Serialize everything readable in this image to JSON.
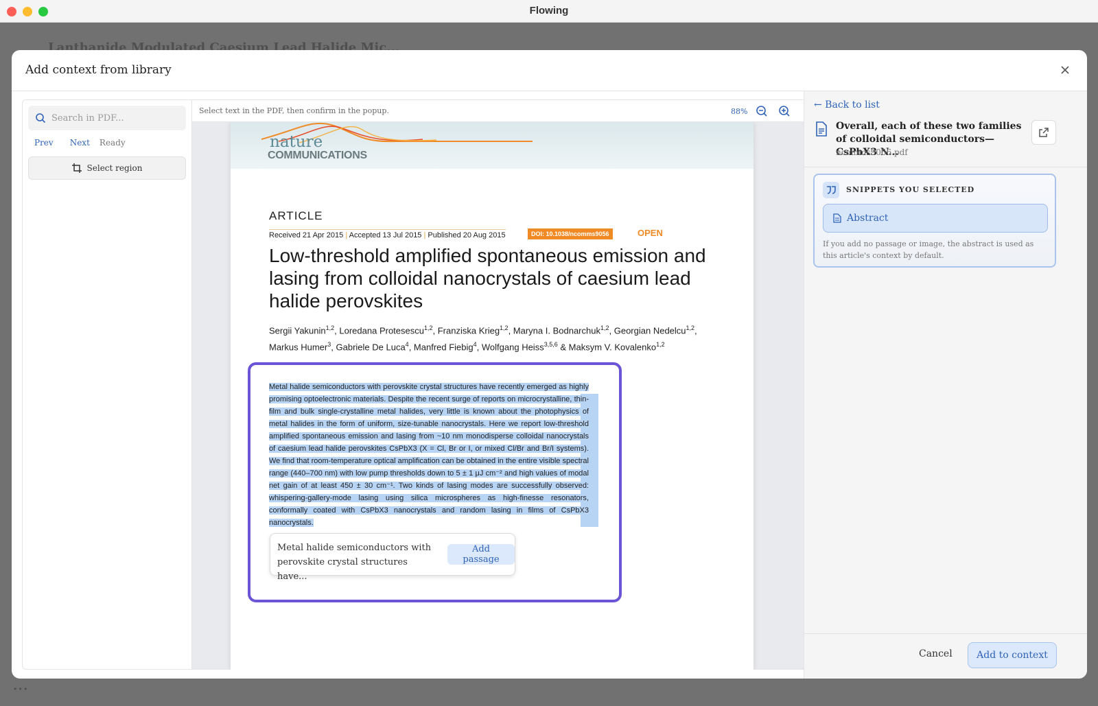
{
  "window": {
    "title": "Flowing"
  },
  "background": {
    "title": "Lanthanide Modulated Caesium Lead Halide Mic...",
    "status": "• • •"
  },
  "modal": {
    "title": "Add context from library",
    "close_icon": "close-icon"
  },
  "sidebar": {
    "search_placeholder": "Search in PDF...",
    "prev_label": "Prev",
    "next_label": "Next",
    "status": "Ready",
    "region_button": "Select region"
  },
  "viewer": {
    "hint": "Select text in the PDF, then confirm in the popup.",
    "zoom": "88%"
  },
  "pdf": {
    "logo_top": "nature",
    "logo_bottom": "COMMUNICATIONS",
    "article_label": "ARTICLE",
    "received": "Received 21 Apr 2015",
    "accepted": "Accepted 13 Jul 2015",
    "published": "Published 20 Aug 2015",
    "doi": "DOI: 10.1038/ncomms9056",
    "open": "OPEN",
    "title": "Low-threshold amplified spontaneous emission and lasing from colloidal nanocrystals of caesium lead halide perovskites",
    "authors": [
      {
        "name": "Sergii Yakunin",
        "aff": "1,2"
      },
      {
        "name": "Loredana Protesescu",
        "aff": "1,2"
      },
      {
        "name": "Franziska Krieg",
        "aff": "1,2"
      },
      {
        "name": "Maryna I. Bodnarchuk",
        "aff": "1,2"
      },
      {
        "name": "Georgian Nedelcu",
        "aff": "1,2"
      },
      {
        "name": "Markus Humer",
        "aff": "3"
      },
      {
        "name": "Gabriele De Luca",
        "aff": "4"
      },
      {
        "name": "Manfred Fiebig",
        "aff": "4"
      },
      {
        "name": "Wolfgang Heiss",
        "aff": "3,5,6"
      },
      {
        "name": "Maksym V. Kovalenko",
        "aff": "1,2"
      }
    ],
    "abstract": "Metal halide semiconductors with perovskite crystal structures have recently emerged as highly promising optoelectronic materials. Despite the recent surge of reports on microcrystalline, thin-film and bulk single-crystalline metal halides, very little is known about the photophysics of metal halides in the form of uniform, size-tunable nanocrystals. Here we report low-threshold amplified spontaneous emission and lasing from ~10 nm monodisperse colloidal nanocrystals of caesium lead halide perovskites CsPbX3 (X = Cl, Br or I, or mixed Cl/Br and Br/I systems). We find that room-temperature optical amplification can be obtained in the entire visible spectral range (440–700 nm) with low pump thresholds down to 5 ± 1 μJ cm⁻² and high values of modal net gain of at least 450 ± 30 cm⁻¹. Two kinds of lasing modes are successfully observed: whispering-gallery-mode lasing using silica microspheres as high-finesse resonators, conformally coated with CsPbX3 nanocrystals and random lasing in films of CsPbX3 nanocrystals."
  },
  "popup": {
    "preview": "Metal halide semiconductors with perovskite crystal structures have...",
    "button": "Add passage"
  },
  "right_panel": {
    "back_label": "← Back to list",
    "doc_title": "Overall, each of these two families of colloidal semiconductors—CsPbX3 N...",
    "file_name": "ncomms9056.pdf",
    "snippets_label": "SNIPPETS YOU SELECTED",
    "snippet_item": "Abstract",
    "snippets_note": "If you add no passage or image, the abstract is used as this article's context by default.",
    "cancel_label": "Cancel",
    "add_label": "Add to context"
  },
  "colors": {
    "accent": "#2f63b8",
    "selection_frame": "#6b54d6",
    "highlight": "#b8d4f5",
    "journal_orange": "#f08a24"
  }
}
